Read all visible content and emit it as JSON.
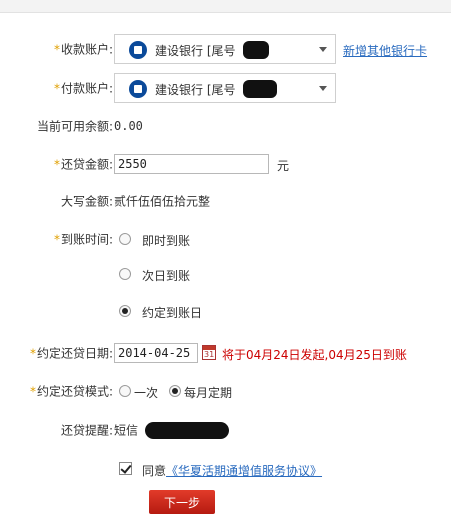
{
  "form": {
    "receive_account": {
      "label": "收款账户:",
      "bank": "建设银行 [尾号",
      "add_link": "新增其他银行卡"
    },
    "pay_account": {
      "label": "付款账户:",
      "bank": "建设银行 [尾号"
    },
    "balance": {
      "label": "当前可用余额:",
      "value": "0.00"
    },
    "amount": {
      "label": "还贷金额:",
      "value": "2550",
      "unit": "元"
    },
    "amount_words": {
      "label": "大写金额:",
      "value": "贰仟伍佰伍拾元整"
    },
    "arrival_time": {
      "label": "到账时间:",
      "options": [
        "即时到账",
        "次日到账",
        "约定到账日"
      ],
      "selected": "约定到账日"
    },
    "scheduled_date": {
      "label": "约定还贷日期:",
      "value": "2014-04-25",
      "calendar_day": "31",
      "hint": "将于04月24日发起,04月25日到账"
    },
    "scheduled_mode": {
      "label": "约定还贷模式:",
      "options": [
        "一次",
        "每月定期"
      ],
      "selected": "每月定期"
    },
    "reminder": {
      "label": "还贷提醒:",
      "value": "短信"
    },
    "agreement": {
      "prefix": "同意",
      "link": "《华夏活期通增值服务协议》"
    },
    "next_button": "下一步"
  },
  "colors": {
    "accent_red": "#cc0000",
    "link_blue": "#2a6bbf",
    "required_star": "#e0a000",
    "button_red": "#c8281a"
  },
  "icons": [
    "ccb-bank-logo-icon",
    "dropdown-caret-icon",
    "calendar-icon",
    "checkbox-checked-icon"
  ]
}
